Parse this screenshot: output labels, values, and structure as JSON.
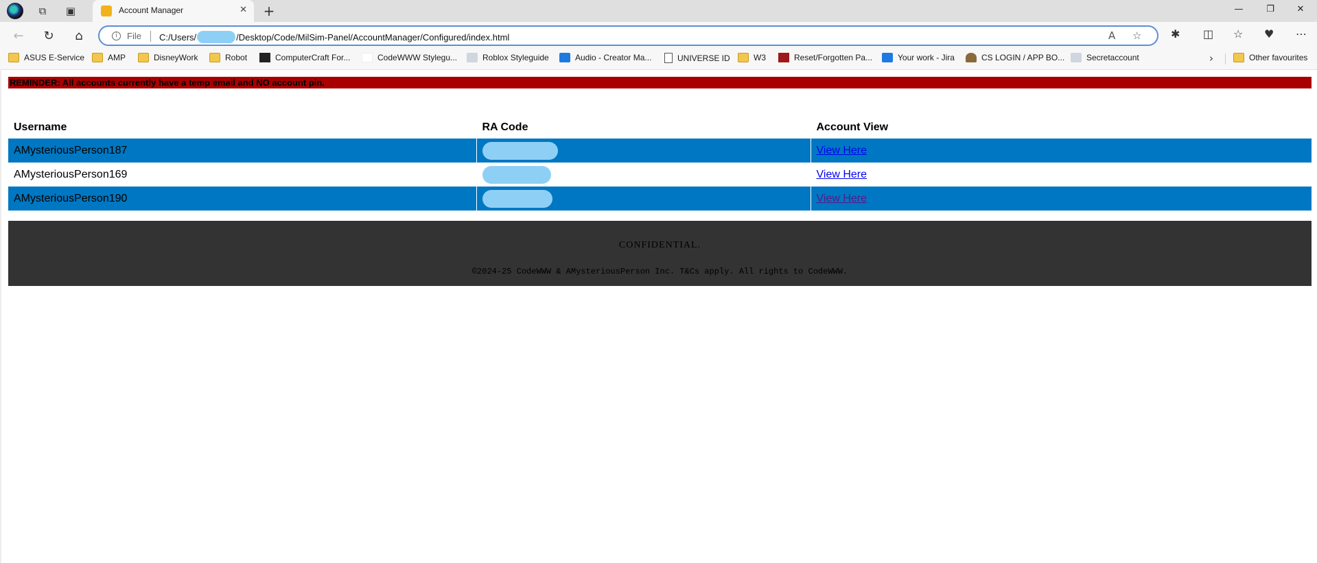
{
  "tab": {
    "title": "Account Manager"
  },
  "addressbar": {
    "scheme_label": "File",
    "url_prefix": "C:/Users/",
    "url_suffix": "/Desktop/Code/MilSim-Panel/AccountManager/Configured/index.html"
  },
  "bookmarks": [
    {
      "label": "ASUS E-Service",
      "icon": "folder-icon"
    },
    {
      "label": "AMP",
      "icon": "folder-icon"
    },
    {
      "label": "DisneyWork",
      "icon": "folder-icon"
    },
    {
      "label": "Robot",
      "icon": "folder-icon"
    },
    {
      "label": "ComputerCraft For...",
      "icon": "terminal-icon"
    },
    {
      "label": "CodeWWW Stylegu...",
      "icon": "blank-page-icon"
    },
    {
      "label": "Roblox Styleguide",
      "icon": "image-icon"
    },
    {
      "label": "Audio - Creator Ma...",
      "icon": "roblox-icon"
    },
    {
      "label": "UNIVERSE ID",
      "icon": "document-icon"
    },
    {
      "label": "W3",
      "icon": "folder-icon"
    },
    {
      "label": "Reset/Forgotten Pa...",
      "icon": "red-site-icon"
    },
    {
      "label": "Your work - Jira",
      "icon": "jira-icon"
    },
    {
      "label": "CS LOGIN / APP BO...",
      "icon": "person-icon"
    },
    {
      "label": "Secretaccount",
      "icon": "image-icon"
    }
  ],
  "other_favourites": "Other favourites",
  "page": {
    "reminder": "REMINDER: All accounts currently have a temp email and NO account pin.",
    "table": {
      "headers": [
        "Username",
        "RA Code",
        "Account View"
      ],
      "rows": [
        {
          "username": "AMysteriousPerson187",
          "ra_code": "",
          "link": "View Here"
        },
        {
          "username": "AMysteriousPerson169",
          "ra_code": "",
          "link": "View Here"
        },
        {
          "username": "AMysteriousPerson190",
          "ra_code": "",
          "link": "View Here"
        }
      ]
    },
    "footer": {
      "title": "CONFIDENTIAL.",
      "copyright": "©2024-25 CodeWWW & AMysteriousPerson Inc. T&Cs apply. All rights to CodeWWW."
    }
  },
  "colors": {
    "reminder_bg": "#a80000",
    "row_alt_bg": "#0077c2",
    "footer_bg": "#333333",
    "link": "#0000ee",
    "visited_link": "#551a8b"
  }
}
